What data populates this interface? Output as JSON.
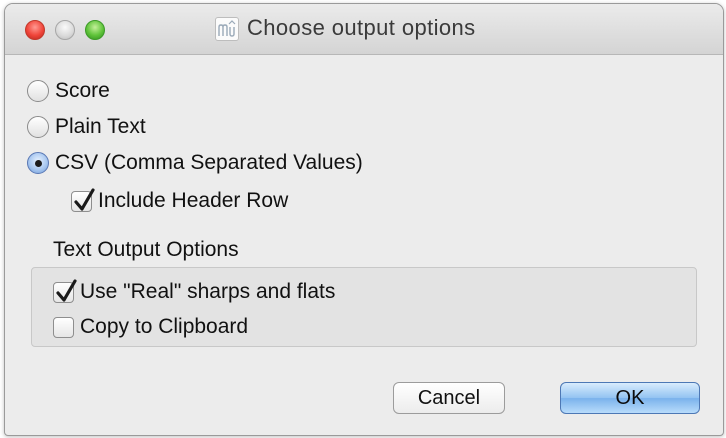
{
  "window": {
    "title": "Choose output options",
    "app_icon_glyph": "m"
  },
  "output_format": {
    "options": [
      {
        "label": "Score",
        "selected": false
      },
      {
        "label": "Plain Text",
        "selected": false
      },
      {
        "label": "CSV (Comma Separated Values)",
        "selected": true
      }
    ],
    "include_header_row": {
      "label": "Include Header Row",
      "checked": true
    }
  },
  "text_output_options": {
    "title": "Text Output Options",
    "real_sharps_flats": {
      "label": "Use \"Real\" sharps and flats",
      "checked": true
    },
    "copy_to_clipboard": {
      "label": "Copy to Clipboard",
      "checked": false
    }
  },
  "buttons": {
    "cancel": "Cancel",
    "ok": "OK"
  },
  "colors": {
    "window_bg": "#ececec",
    "accent_blue": "#7ab2ec",
    "close_red": "#f0453a",
    "zoom_green": "#5fc33a",
    "check_color": "#1a1a1a"
  }
}
